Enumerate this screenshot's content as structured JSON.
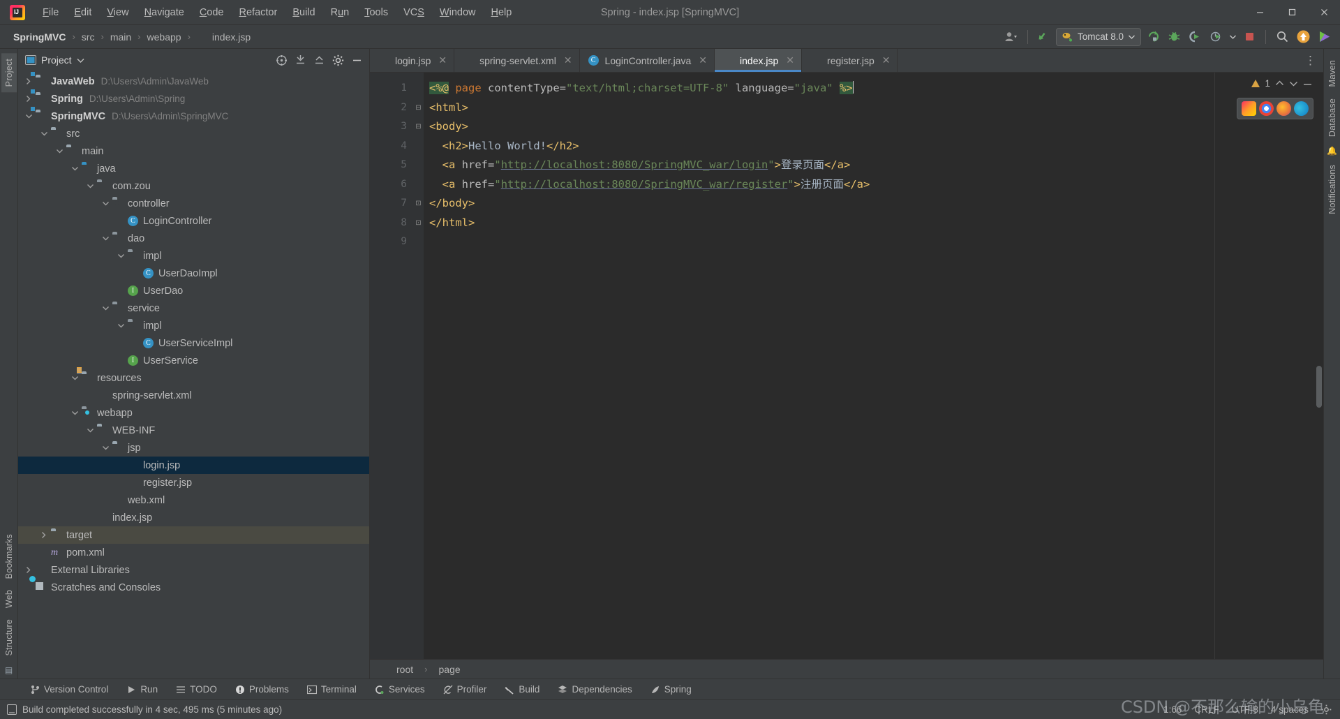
{
  "window": {
    "title": "Spring - index.jsp [SpringMVC]",
    "minimize": "–",
    "maximize": "❐",
    "close": "✕"
  },
  "menu": [
    {
      "label": "File",
      "mnemonic": "F"
    },
    {
      "label": "Edit",
      "mnemonic": "E"
    },
    {
      "label": "View",
      "mnemonic": "V"
    },
    {
      "label": "Navigate",
      "mnemonic": "N"
    },
    {
      "label": "Code",
      "mnemonic": "C"
    },
    {
      "label": "Refactor",
      "mnemonic": "R"
    },
    {
      "label": "Build",
      "mnemonic": "B"
    },
    {
      "label": "Run",
      "mnemonic": "u"
    },
    {
      "label": "Tools",
      "mnemonic": "T"
    },
    {
      "label": "VCS",
      "mnemonic": "S"
    },
    {
      "label": "Window",
      "mnemonic": "W"
    },
    {
      "label": "Help",
      "mnemonic": "H"
    }
  ],
  "breadcrumbs": [
    "SpringMVC",
    "src",
    "main",
    "webapp",
    "index.jsp"
  ],
  "toolbar": {
    "run_config": "Tomcat 8.0",
    "account_icon": "account-icon",
    "updates_icon": "update-arrow-icon",
    "rerun_icon": "rerun-icon",
    "debug_icon": "debug-icon",
    "coverage_icon": "run-coverage-icon",
    "profile_icon": "profiler-icon",
    "stop_icon": "stop-icon",
    "search_icon": "search-everywhere-icon",
    "notify_icon": "upload-icon",
    "ide_icon": "ide-features-icon"
  },
  "project_panel": {
    "title": "Project",
    "buttons": [
      "select-opened-file",
      "expand-all",
      "collapse-all",
      "settings",
      "hide"
    ],
    "tree": [
      {
        "indent": 0,
        "arrow": "›",
        "icon": "module",
        "label": "JavaWeb",
        "bold": true,
        "path": "D:\\Users\\Admin\\JavaWeb"
      },
      {
        "indent": 0,
        "arrow": "›",
        "icon": "module",
        "label": "Spring",
        "bold": true,
        "path": "D:\\Users\\Admin\\Spring"
      },
      {
        "indent": 0,
        "arrow": "⌄",
        "icon": "module",
        "label": "SpringMVC",
        "bold": true,
        "path": "D:\\Users\\Admin\\SpringMVC"
      },
      {
        "indent": 1,
        "arrow": "⌄",
        "icon": "folder",
        "label": "src",
        "bold": false,
        "path": ""
      },
      {
        "indent": 2,
        "arrow": "⌄",
        "icon": "folder",
        "label": "main",
        "bold": false,
        "path": ""
      },
      {
        "indent": 3,
        "arrow": "⌄",
        "icon": "folder-blue",
        "label": "java",
        "bold": false,
        "path": ""
      },
      {
        "indent": 4,
        "arrow": "⌄",
        "icon": "package",
        "label": "com.zou",
        "bold": false,
        "path": ""
      },
      {
        "indent": 5,
        "arrow": "⌄",
        "icon": "package",
        "label": "controller",
        "bold": false,
        "path": ""
      },
      {
        "indent": 6,
        "arrow": "",
        "icon": "class",
        "label": "LoginController",
        "bold": false,
        "path": ""
      },
      {
        "indent": 5,
        "arrow": "⌄",
        "icon": "package",
        "label": "dao",
        "bold": false,
        "path": ""
      },
      {
        "indent": 6,
        "arrow": "⌄",
        "icon": "package",
        "label": "impl",
        "bold": false,
        "path": ""
      },
      {
        "indent": 7,
        "arrow": "",
        "icon": "class",
        "label": "UserDaoImpl",
        "bold": false,
        "path": ""
      },
      {
        "indent": 6,
        "arrow": "",
        "icon": "interface",
        "label": "UserDao",
        "bold": false,
        "path": ""
      },
      {
        "indent": 5,
        "arrow": "⌄",
        "icon": "package",
        "label": "service",
        "bold": false,
        "path": ""
      },
      {
        "indent": 6,
        "arrow": "⌄",
        "icon": "package",
        "label": "impl",
        "bold": false,
        "path": ""
      },
      {
        "indent": 7,
        "arrow": "",
        "icon": "class",
        "label": "UserServiceImpl",
        "bold": false,
        "path": ""
      },
      {
        "indent": 6,
        "arrow": "",
        "icon": "interface",
        "label": "UserService",
        "bold": false,
        "path": ""
      },
      {
        "indent": 3,
        "arrow": "⌄",
        "icon": "resources",
        "label": "resources",
        "bold": false,
        "path": ""
      },
      {
        "indent": 4,
        "arrow": "",
        "icon": "xml-spring",
        "label": "spring-servlet.xml",
        "bold": false,
        "path": ""
      },
      {
        "indent": 3,
        "arrow": "⌄",
        "icon": "webapp",
        "label": "webapp",
        "bold": false,
        "path": ""
      },
      {
        "indent": 4,
        "arrow": "⌄",
        "icon": "folder",
        "label": "WEB-INF",
        "bold": false,
        "path": ""
      },
      {
        "indent": 5,
        "arrow": "⌄",
        "icon": "folder",
        "label": "jsp",
        "bold": false,
        "path": ""
      },
      {
        "indent": 6,
        "arrow": "",
        "icon": "jsp",
        "label": "login.jsp",
        "bold": false,
        "path": "",
        "selected": true
      },
      {
        "indent": 6,
        "arrow": "",
        "icon": "jsp",
        "label": "register.jsp",
        "bold": false,
        "path": ""
      },
      {
        "indent": 5,
        "arrow": "",
        "icon": "xml",
        "label": "web.xml",
        "bold": false,
        "path": ""
      },
      {
        "indent": 4,
        "arrow": "",
        "icon": "jsp",
        "label": "index.jsp",
        "bold": false,
        "path": ""
      },
      {
        "indent": 1,
        "arrow": "›",
        "icon": "folder-target",
        "label": "target",
        "bold": false,
        "path": "",
        "highlight": true
      },
      {
        "indent": 1,
        "arrow": "",
        "icon": "maven",
        "label": "pom.xml",
        "bold": false,
        "path": ""
      },
      {
        "indent": 0,
        "arrow": "›",
        "icon": "library",
        "label": "External Libraries",
        "bold": false,
        "path": ""
      },
      {
        "indent": 0,
        "arrow": "",
        "icon": "scratch",
        "label": "Scratches and Consoles",
        "bold": false,
        "path": ""
      }
    ]
  },
  "left_strip_tabs": [
    "Project",
    "Bookmarks",
    "Web",
    "Structure"
  ],
  "right_strip_tabs": [
    "Maven",
    "Database",
    "Notifications"
  ],
  "editor": {
    "tabs": [
      {
        "label": "login.jsp",
        "icon": "jsp-file-icon",
        "active": false
      },
      {
        "label": "spring-servlet.xml",
        "icon": "spring-xml-icon",
        "active": false
      },
      {
        "label": "LoginController.java",
        "icon": "java-class-icon",
        "active": false
      },
      {
        "label": "index.jsp",
        "icon": "jsp-file-icon",
        "active": true
      },
      {
        "label": "register.jsp",
        "icon": "jsp-file-icon",
        "active": false
      }
    ],
    "close_glyph": "✕",
    "line_numbers": [
      "1",
      "2",
      "3",
      "4",
      "5",
      "6",
      "7",
      "8",
      "9"
    ],
    "warning_count": "1",
    "code_lines": [
      {
        "n": 1,
        "tokens": [
          {
            "t": "<%@",
            "c": "k-dir"
          },
          {
            "t": " ",
            "c": "k-txt"
          },
          {
            "t": "page",
            "c": "k-kw"
          },
          {
            "t": " contentType=",
            "c": "k-attr"
          },
          {
            "t": "\"text/html;charset=UTF-8\"",
            "c": "k-str"
          },
          {
            "t": " language=",
            "c": "k-attr"
          },
          {
            "t": "\"java\"",
            "c": "k-str"
          },
          {
            "t": " ",
            "c": "k-txt"
          },
          {
            "t": "%>",
            "c": "k-dir"
          }
        ]
      },
      {
        "n": 2,
        "tokens": [
          {
            "t": "<html>",
            "c": "k-tag"
          }
        ]
      },
      {
        "n": 3,
        "tokens": [
          {
            "t": "<body>",
            "c": "k-tag"
          }
        ]
      },
      {
        "n": 4,
        "tokens": [
          {
            "t": "  ",
            "c": "k-txt"
          },
          {
            "t": "<h2>",
            "c": "k-tag"
          },
          {
            "t": "Hello World!",
            "c": "k-txt"
          },
          {
            "t": "</h2>",
            "c": "k-tag"
          }
        ]
      },
      {
        "n": 5,
        "tokens": [
          {
            "t": "  ",
            "c": "k-txt"
          },
          {
            "t": "<a ",
            "c": "k-tag"
          },
          {
            "t": "href=",
            "c": "k-attr"
          },
          {
            "t": "\"",
            "c": "k-str"
          },
          {
            "t": "http://localhost:8080/SpringMVC_war/login",
            "c": "k-link"
          },
          {
            "t": "\"",
            "c": "k-str"
          },
          {
            "t": ">",
            "c": "k-tag"
          },
          {
            "t": "登录页面",
            "c": "k-txt"
          },
          {
            "t": "</a>",
            "c": "k-tag"
          }
        ]
      },
      {
        "n": 6,
        "tokens": [
          {
            "t": "  ",
            "c": "k-txt"
          },
          {
            "t": "<a ",
            "c": "k-tag"
          },
          {
            "t": "href=",
            "c": "k-attr"
          },
          {
            "t": "\"",
            "c": "k-str"
          },
          {
            "t": "http://localhost:8080/SpringMVC_war/register",
            "c": "k-link"
          },
          {
            "t": "\"",
            "c": "k-str"
          },
          {
            "t": ">",
            "c": "k-tag"
          },
          {
            "t": "注册页面",
            "c": "k-txt"
          },
          {
            "t": "</a>",
            "c": "k-tag"
          }
        ]
      },
      {
        "n": 7,
        "tokens": [
          {
            "t": "</body>",
            "c": "k-tag"
          }
        ]
      },
      {
        "n": 8,
        "tokens": [
          {
            "t": "</html>",
            "c": "k-tag"
          }
        ]
      },
      {
        "n": 9,
        "tokens": []
      }
    ],
    "breadcrumb": [
      "root",
      "page"
    ],
    "breadcrumb_sep": "›"
  },
  "bottom_tools": [
    {
      "label": "Version Control",
      "icon": "branch-icon"
    },
    {
      "label": "Run",
      "icon": "play-icon"
    },
    {
      "label": "TODO",
      "icon": "todo-list-icon"
    },
    {
      "label": "Problems",
      "icon": "problems-icon"
    },
    {
      "label": "Terminal",
      "icon": "terminal-icon"
    },
    {
      "label": "Services",
      "icon": "services-icon"
    },
    {
      "label": "Profiler",
      "icon": "profiler-icon"
    },
    {
      "label": "Build",
      "icon": "build-hammer-icon"
    },
    {
      "label": "Dependencies",
      "icon": "dependencies-icon"
    },
    {
      "label": "Spring",
      "icon": "spring-leaf-icon"
    }
  ],
  "status": {
    "message": "Build completed successfully in 4 sec, 495 ms (5 minutes ago)",
    "caret_position": "1:66",
    "line_separator": "CRLF",
    "encoding": "UTF-8",
    "indent": "4 spaces",
    "watermark": "CSDN @不那么输的小乌龟"
  },
  "colors": {
    "accent": "#4a88c7",
    "background": "#3c3f41",
    "editor_bg": "#2b2b2b",
    "selection": "#0d293e",
    "string": "#6a8759",
    "tag": "#e8bf6a",
    "keyword": "#cc7832"
  }
}
